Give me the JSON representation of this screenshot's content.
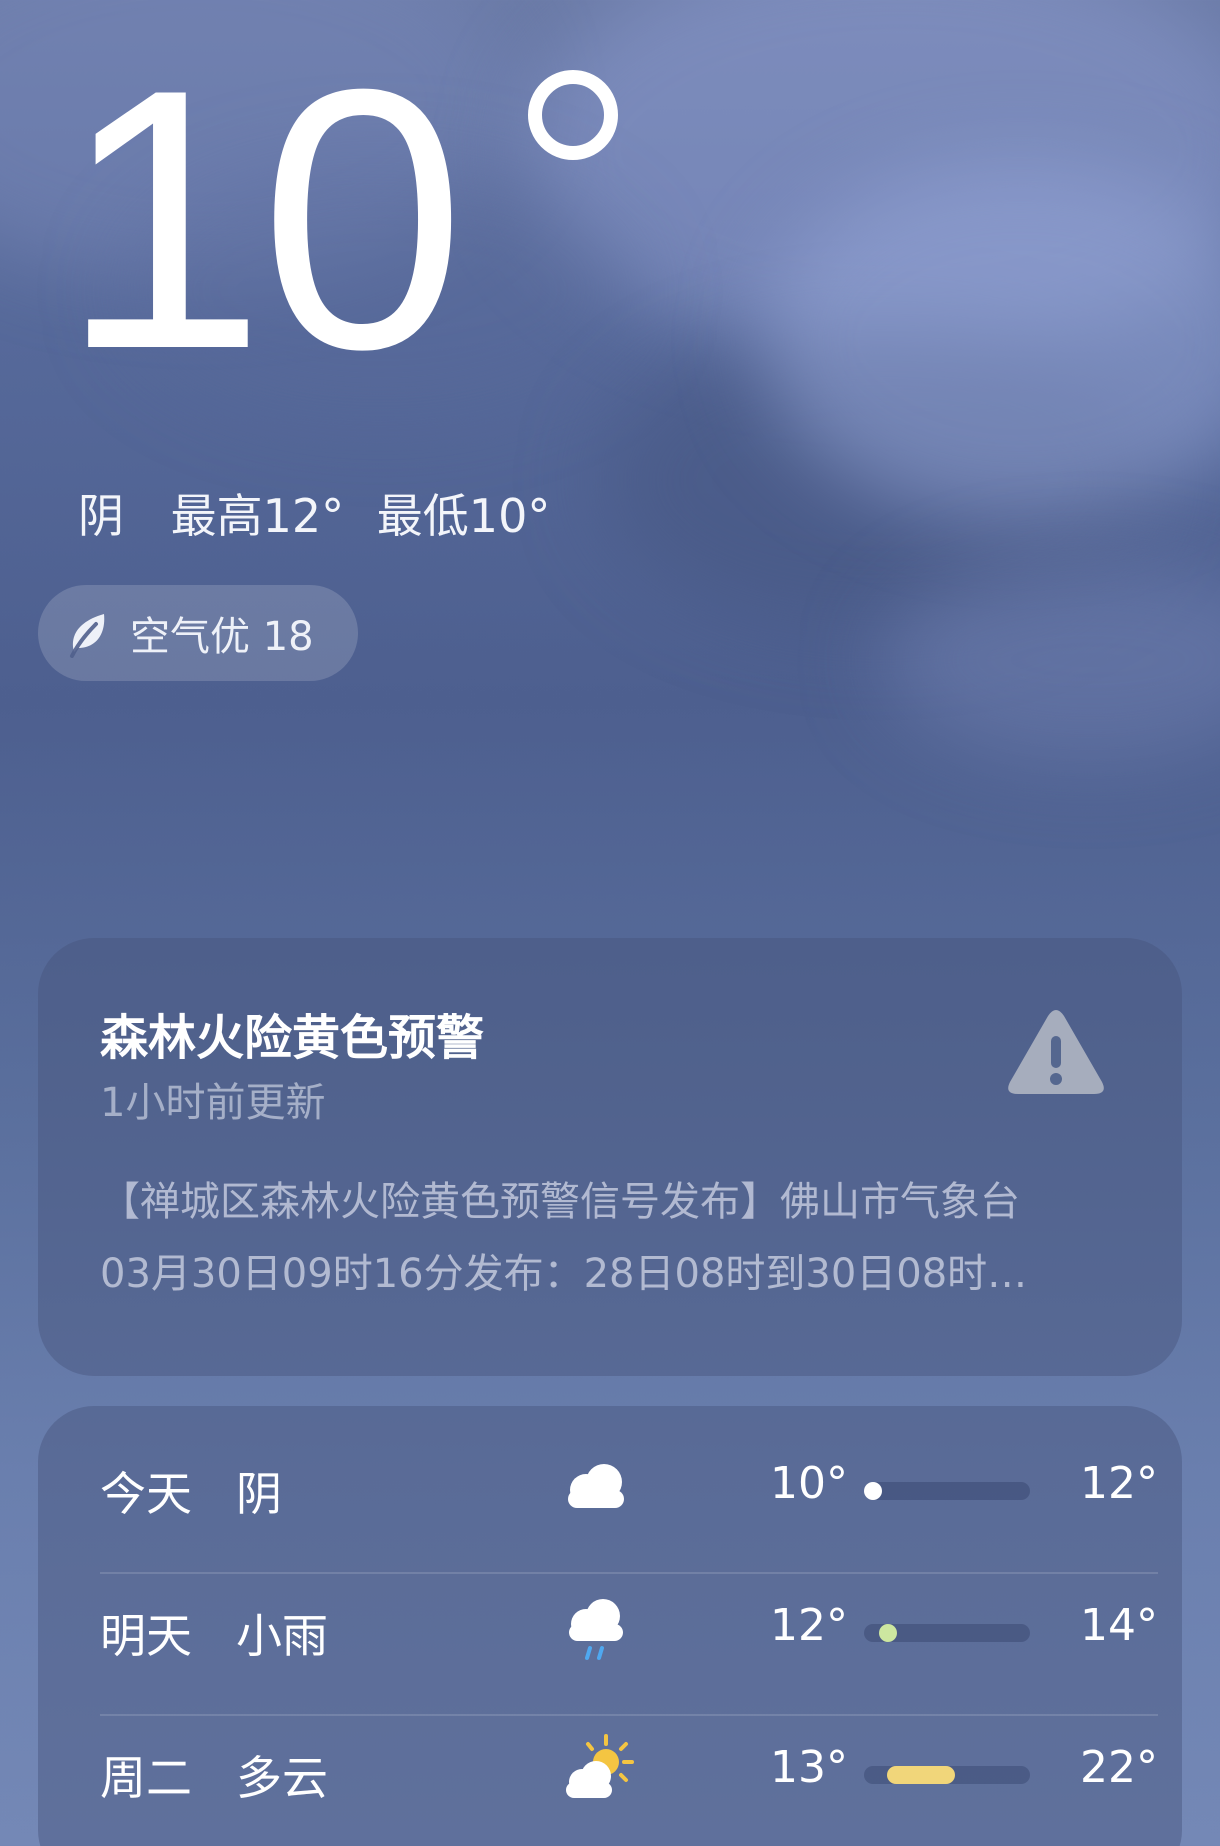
{
  "current": {
    "temperature": "10",
    "condition": "阴",
    "high": "最高12°",
    "low": "最低10°"
  },
  "air_quality": {
    "label": "空气优 18",
    "icon": "leaf-icon"
  },
  "alert": {
    "title": "森林火险黄色预警",
    "updated": "1小时前更新",
    "body_line1": "【禅城区森林火险黄色预警信号发布】佛山市气象台",
    "body_line2": "03月30日09时16分发布：28日08时到30日08时…",
    "icon": "warning-icon",
    "icon_color": "#a6adbd"
  },
  "forecast": [
    {
      "day": "今天",
      "condition": "阴",
      "icon": "cloudy-icon",
      "low": "10°",
      "high": "12°",
      "range_min": 10,
      "range_max": 12,
      "bar_color": "#ffffff"
    },
    {
      "day": "明天",
      "condition": "小雨",
      "icon": "light-rain-icon",
      "low": "12°",
      "high": "14°",
      "range_min": 12,
      "range_max": 14,
      "bar_color": "#cde7a0"
    },
    {
      "day": "周二",
      "condition": "多云",
      "icon": "partly-cloudy-icon",
      "low": "13°",
      "high": "22°",
      "range_min": 13,
      "range_max": 22,
      "bar_color": "#f1d67a"
    }
  ],
  "forecast_scale": {
    "min": 10,
    "max": 32
  }
}
